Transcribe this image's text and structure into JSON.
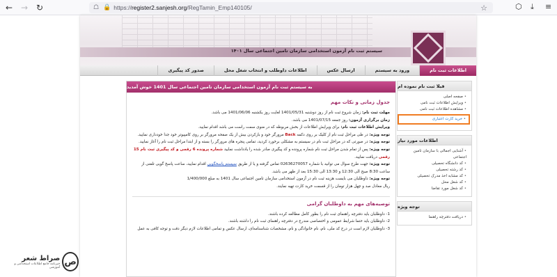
{
  "browser": {
    "back_icon": "arrow-left-icon",
    "forward_icon": "arrow-right-icon",
    "reload_icon": "reload-icon",
    "url_prefix": "https://",
    "url_domain": "register2.sanjesh.org",
    "url_path": "/RegTamin_Emp140105/"
  },
  "banner": {
    "title": "سیستم ثبت نام آزمون استخدامی سازمان تامین اجتماعی سال ۱۴۰۱"
  },
  "menu": {
    "items": [
      {
        "label": "اطلاعات ثبت نام",
        "active": true
      },
      {
        "label": "ورود به سیستم",
        "active": false
      },
      {
        "label": "ارسال عکس",
        "active": false
      },
      {
        "label": "اطلاعات داوطلب و انتخاب شغل محل",
        "active": false
      },
      {
        "label": "صدور کد پیگیری",
        "active": false
      }
    ]
  },
  "sidebar": {
    "box1": {
      "title": "قبلا ثبت نام نموده ام",
      "items": [
        "صفحه اصلی",
        "ویرایش اطلاعات ثبت نامی",
        "مشاهده اطلاعات ثبت نامی",
        "خرید کارت اعتباری"
      ]
    },
    "box2": {
      "title": "اطلاعات مورد نیاز",
      "items": [
        "آشنایی اجمالی با سازمان تامین اجتماعی",
        "کد دانشگاه تحصیلی",
        "کد رشته تحصیلی",
        "کد مشابه اخذ مدرک تحصیلی",
        "کد شغل محل",
        "کد شغل مورد تقاضا"
      ]
    },
    "box3": {
      "title": "توجه ویژه",
      "items": [
        "دریافت دفترچه راهنما"
      ]
    }
  },
  "main": {
    "header": "به سیستم ثبت نام آزمون استخدامی سازمان تامین اجتماعی سال 1401 خوش آمدید",
    "section1_title": "جدول زمانی و نکات مهم",
    "lines": {
      "l1_label": "مهلت ثبت نام:",
      "l1_text": " زمان شروع ثبت نام از روز دوشنبه 1401/05/31 لغایت روز یکشنبه 1401/06/06 می باشد.",
      "l2_label": "زمان برگزاری آزمون:",
      "l2_text": " روز جمعه 1401/07/15 می باشد.",
      "l3_label": "ویرایش اطلاعات ثبت نام:",
      "l3_text": " برای ویرایش اطلاعات از بخش مربوطه که در منوی سمت راست می باشد اقدام نمایید.",
      "l4_label": "توجه ویژه:",
      "l4_text_a": " در طی مراحل ثبت نام از کلیک بر روی دکمه ",
      "l4_back": "Back",
      "l4_text_b": " مرورگر خود و بازکردن بیش از یک صفحه مرورگر بر روی کامپیوتر خود جدا خودداری نمایید.",
      "l5_label": "توجه ویژه:",
      "l5_text": " در صورتی که در مراحل ثبت نام در سیستم به مشکلی برخورد کردید، تمامی پنجره های مرورگر را بسته و از ابتدا مراحل ثبت نام را آغاز نمایید.",
      "l6_label": "توجه ویژه:",
      "l6_text_a": " پس از تمام شدن مراحل ثبت نام شماره پرونده و کد پیگیری صادر شده را یادداشت نمایید ",
      "l6_red": "شماره پرونده 6 رقمی و کد پیگیری ثبت نام 15 رقمی",
      "l6_text_b": " دریافت نمایید.",
      "l7_label": "توجه ویژه:",
      "l7_text_a": " جهت طرح سوال می توانید با شماره 02636270057 تماس گرفته و یا از طریق ",
      "l7_link": "سیستم پاسخگویی",
      "l7_text_b": " اقدام نمایید، ساعت پاسخ گویی تلفنی از",
      "l8_text": "ساعت 8:30 صبح الی 12:30 و 13:30 الی 15:30 بعد از ظهر می باشد.",
      "l9_label": "توجه ویژه:",
      "l9_text": " داوطلبان می بایست هزینه ثبت نام در آزمون استخدامی سازمان تامین اجتماعی سال 1401 به مبلغ 1/400/000",
      "l10_text": "ریال معادل صد و چهل هزار تومان را از قسمت خرید کارت تهیه نمایند."
    },
    "section2_title": "توصیه‌های مهم به داوطلبان گرامی",
    "tips": [
      "1- داوطلبان باید دفترچه راهنمای ثبت نام را بطور کامل مطالعه کرده باشند.",
      "2- داوطلبان باید حتما شرایط عمومی و اختصاصی مندرج در دفترچه راهنمای ثبت نام را داشته باشند.",
      "3- داوطلبان لازم است در درج کد ملی، نام، نام خانوادگی و نام، مشخصات شناسنامه‌ای، ارسال عکس و تمامی اطلاعات لازم دیگر دقت و توجه کافی به عمل"
    ]
  },
  "watermark": {
    "line1": "صراط شعر",
    "line2": "خبرنامه جامع اطلاعات استخدامی و آموزشی"
  }
}
